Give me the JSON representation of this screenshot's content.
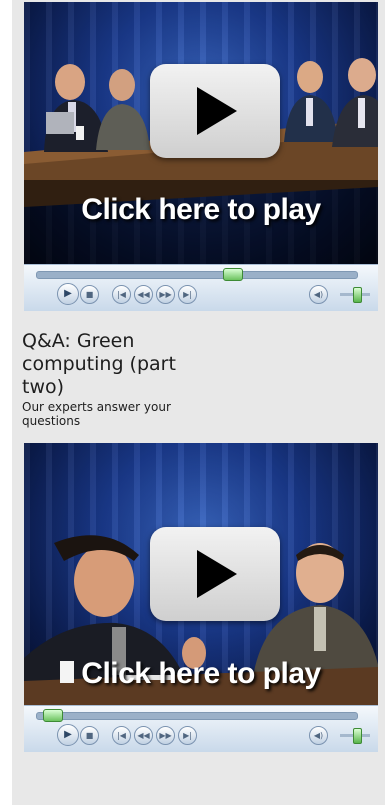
{
  "videos": [
    {
      "caption": "Click here to play",
      "play_icon": "play-triangle-icon",
      "controls": {
        "play": "▶",
        "stop": "■",
        "prev": "|◀",
        "rewind": "◀◀",
        "fast_forward": "▶▶",
        "next": "▶|",
        "mute": "◀)"
      },
      "progress_fraction": 0.62,
      "volume_fraction": 0.75
    },
    {
      "caption": "Click here to play",
      "play_icon": "play-triangle-icon",
      "controls": {
        "play": "▶",
        "stop": "■",
        "prev": "|◀",
        "rewind": "◀◀",
        "fast_forward": "▶▶",
        "next": "▶|",
        "mute": "◀)"
      },
      "progress_fraction": 0.02,
      "volume_fraction": 0.75
    }
  ],
  "item": {
    "title": "Q&A: Green computing (part two)",
    "subtitle": "Our experts answer your questions"
  },
  "colors": {
    "panel_bg": "#e8e8e8",
    "stage_blue": "#1a3a8e",
    "control_bar": "#c9d9ea",
    "seek_green": "#6cc35f"
  }
}
